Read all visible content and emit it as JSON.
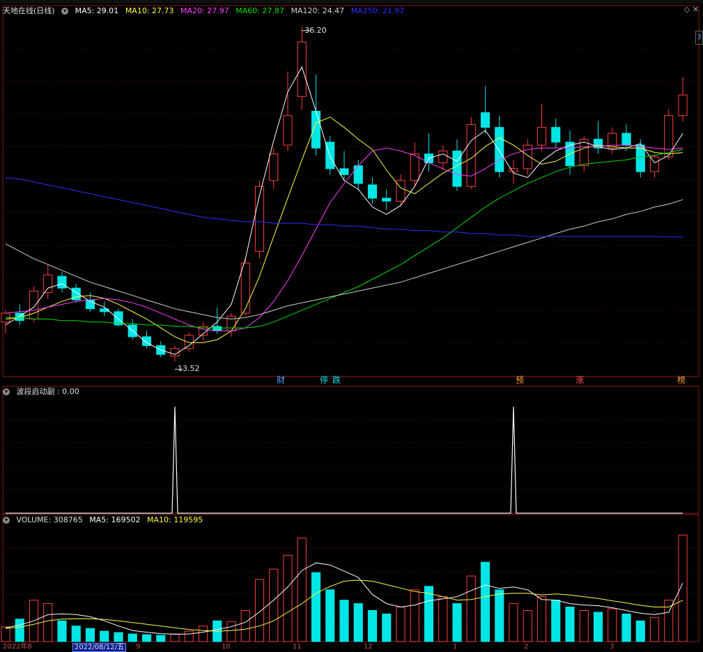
{
  "main_header": {
    "title": "天地在线(日线)",
    "ma5": "MA5: 29.01",
    "ma10": "MA10: 27.73",
    "ma20": "MA20: 27.97",
    "ma60": "MA60: 27.87",
    "ma120": "MA120: 24.47",
    "ma250": "MA250: 21.97"
  },
  "indicator_header": {
    "label": "波段启动副 : 0.00"
  },
  "volume_header": {
    "volume": "VOLUME: 308765",
    "ma5": "MA5: 169502",
    "ma10": "MA10: 119595"
  },
  "annotations": {
    "high": "36.20",
    "low": "13.52"
  },
  "event_markers": [
    {
      "label": "财",
      "color": "#4aa3ff"
    },
    {
      "label": "停",
      "color": "#00e5e5"
    },
    {
      "label": "跌",
      "color": "#00e5e5"
    },
    {
      "label": "预",
      "color": "#ff9933"
    },
    {
      "label": "涨",
      "color": "#ff5555"
    },
    {
      "label": "榜",
      "color": "#ff9933"
    }
  ],
  "x_axis": {
    "selected_date": "2022/08/12/五",
    "months": [
      "2022年8",
      "9",
      "10",
      "11",
      "12",
      "1",
      "2",
      "3"
    ]
  },
  "scale_button": "3",
  "colors": {
    "up": "#ff4040",
    "down": "#00e5e5",
    "ma5": "#ffffff",
    "ma10": "#ffff40",
    "ma20": "#ff40ff",
    "ma60": "#00e000",
    "ma120": "#d0d0d0",
    "ma250": "#3030ff"
  },
  "chart_data": [
    {
      "type": "candlestick",
      "title": "天地在线(日线)",
      "ylim": [
        12.5,
        37.0
      ],
      "grid": true,
      "series": [
        {
          "name": "MA5",
          "values": [
            16.0,
            16.6,
            17.2,
            18.5,
            18.8,
            18.2,
            17.6,
            17.2,
            16.4,
            15.6,
            14.8,
            14.3,
            14.0,
            14.6,
            15.4,
            16.2,
            17.4,
            20.5,
            24.8,
            28.5,
            31.8,
            33.5,
            30.5,
            27.4,
            25.8,
            25.2,
            24.0,
            23.5,
            24.1,
            25.4,
            27.3,
            27.6,
            27.1,
            28.5,
            29.2,
            27.8,
            26.3,
            26.0,
            27.1,
            27.8,
            28.2,
            28.4,
            28.1,
            27.9,
            28.0,
            28.3,
            27.0,
            27.5,
            29.0
          ]
        },
        {
          "name": "MA10",
          "values": [
            16.4,
            16.5,
            16.8,
            17.2,
            17.6,
            17.9,
            18.0,
            17.8,
            17.4,
            16.9,
            16.4,
            15.8,
            15.2,
            14.8,
            14.8,
            15.0,
            15.6,
            17.1,
            19.3,
            22.0,
            24.6,
            27.2,
            29.7,
            30.1,
            29.4,
            28.6,
            27.9,
            26.5,
            25.3,
            24.9,
            25.6,
            26.3,
            26.8,
            27.3,
            28.1,
            28.7,
            28.2,
            27.5,
            26.9,
            27.1,
            27.6,
            28.0,
            28.2,
            28.1,
            28.0,
            28.0,
            27.7,
            27.6,
            27.7
          ]
        },
        {
          "name": "MA20",
          "values": [
            16.8,
            16.9,
            17.0,
            17.2,
            17.4,
            17.6,
            17.7,
            17.8,
            17.7,
            17.5,
            17.2,
            16.8,
            16.4,
            16.0,
            15.7,
            15.6,
            15.6,
            15.8,
            16.5,
            17.6,
            19.0,
            20.7,
            22.5,
            24.3,
            25.6,
            26.8,
            27.8,
            28.0,
            27.8,
            27.5,
            27.0,
            26.6,
            26.2,
            26.1,
            26.6,
            27.2,
            27.6,
            27.9,
            28.0,
            28.0,
            28.0,
            28.1,
            28.1,
            28.2,
            28.2,
            28.1,
            28.0,
            27.9,
            28.0
          ]
        },
        {
          "name": "MA60",
          "values": [
            16.5,
            16.5,
            16.4,
            16.4,
            16.3,
            16.3,
            16.2,
            16.2,
            16.1,
            16.1,
            16.0,
            16.0,
            15.9,
            15.9,
            15.8,
            15.8,
            15.8,
            15.8,
            15.9,
            16.2,
            16.6,
            17.0,
            17.4,
            17.8,
            18.2,
            18.6,
            19.1,
            19.6,
            20.1,
            20.7,
            21.3,
            21.9,
            22.6,
            23.3,
            24.0,
            24.6,
            25.1,
            25.6,
            26.0,
            26.4,
            26.7,
            26.9,
            27.0,
            27.1,
            27.2,
            27.4,
            27.5,
            27.7,
            27.9
          ]
        },
        {
          "name": "MA120",
          "values": [
            21.5,
            21.0,
            20.5,
            20.1,
            19.7,
            19.3,
            18.9,
            18.6,
            18.3,
            18.0,
            17.7,
            17.4,
            17.1,
            16.9,
            16.7,
            16.5,
            16.4,
            16.5,
            16.7,
            17.0,
            17.3,
            17.5,
            17.7,
            17.9,
            18.1,
            18.3,
            18.5,
            18.7,
            18.9,
            19.2,
            19.5,
            19.8,
            20.1,
            20.4,
            20.7,
            21.0,
            21.3,
            21.6,
            21.9,
            22.2,
            22.5,
            22.7,
            23.0,
            23.2,
            23.5,
            23.7,
            24.0,
            24.2,
            24.5
          ]
        },
        {
          "name": "MA250",
          "values": [
            26.0,
            25.9,
            25.7,
            25.5,
            25.3,
            25.1,
            24.9,
            24.7,
            24.5,
            24.3,
            24.1,
            23.9,
            23.7,
            23.5,
            23.3,
            23.2,
            23.1,
            23.0,
            23.0,
            22.9,
            22.9,
            22.9,
            22.8,
            22.8,
            22.7,
            22.7,
            22.6,
            22.5,
            22.5,
            22.4,
            22.4,
            22.3,
            22.3,
            22.2,
            22.2,
            22.1,
            22.1,
            22.0,
            22.0,
            22.0,
            22.0,
            22.0,
            22.0,
            22.0,
            22.0,
            22.0,
            22.0,
            21.97,
            21.97
          ]
        }
      ],
      "candles": [
        {
          "o": 16.2,
          "h": 17.0,
          "l": 15.4,
          "c": 16.8
        },
        {
          "o": 16.8,
          "h": 17.4,
          "l": 16.0,
          "c": 16.3
        },
        {
          "o": 16.4,
          "h": 18.6,
          "l": 16.2,
          "c": 18.3
        },
        {
          "o": 18.2,
          "h": 20.1,
          "l": 17.8,
          "c": 19.4
        },
        {
          "o": 19.3,
          "h": 19.6,
          "l": 18.2,
          "c": 18.5
        },
        {
          "o": 18.5,
          "h": 18.8,
          "l": 17.5,
          "c": 17.7
        },
        {
          "o": 17.7,
          "h": 18.2,
          "l": 16.9,
          "c": 17.1
        },
        {
          "o": 17.1,
          "h": 17.6,
          "l": 16.6,
          "c": 16.9
        },
        {
          "o": 16.9,
          "h": 17.1,
          "l": 15.9,
          "c": 16.0
        },
        {
          "o": 16.0,
          "h": 16.4,
          "l": 15.0,
          "c": 15.2
        },
        {
          "o": 15.2,
          "h": 15.6,
          "l": 14.4,
          "c": 14.6
        },
        {
          "o": 14.6,
          "h": 14.9,
          "l": 13.8,
          "c": 14.0
        },
        {
          "o": 13.9,
          "h": 14.6,
          "l": 13.52,
          "c": 14.4
        },
        {
          "o": 14.4,
          "h": 15.5,
          "l": 14.2,
          "c": 15.3
        },
        {
          "o": 15.3,
          "h": 16.2,
          "l": 14.9,
          "c": 15.9
        },
        {
          "o": 15.9,
          "h": 17.2,
          "l": 15.4,
          "c": 15.6
        },
        {
          "o": 15.6,
          "h": 16.8,
          "l": 15.2,
          "c": 16.6
        },
        {
          "o": 16.8,
          "h": 20.6,
          "l": 16.6,
          "c": 20.2
        },
        {
          "o": 21.0,
          "h": 25.8,
          "l": 20.5,
          "c": 25.4
        },
        {
          "o": 25.8,
          "h": 28.0,
          "l": 25.2,
          "c": 27.6
        },
        {
          "o": 28.2,
          "h": 33.2,
          "l": 27.8,
          "c": 30.2
        },
        {
          "o": 31.5,
          "h": 36.2,
          "l": 30.6,
          "c": 35.2
        },
        {
          "o": 30.5,
          "h": 33.0,
          "l": 27.5,
          "c": 28.0
        },
        {
          "o": 28.4,
          "h": 28.8,
          "l": 26.2,
          "c": 26.6
        },
        {
          "o": 26.6,
          "h": 27.8,
          "l": 25.8,
          "c": 26.2
        },
        {
          "o": 26.8,
          "h": 27.2,
          "l": 25.2,
          "c": 25.6
        },
        {
          "o": 25.5,
          "h": 26.0,
          "l": 24.2,
          "c": 24.6
        },
        {
          "o": 24.6,
          "h": 25.2,
          "l": 23.8,
          "c": 24.4
        },
        {
          "o": 24.4,
          "h": 26.2,
          "l": 24.1,
          "c": 25.8
        },
        {
          "o": 25.8,
          "h": 28.4,
          "l": 25.4,
          "c": 27.6
        },
        {
          "o": 27.6,
          "h": 29.0,
          "l": 26.4,
          "c": 27.0
        },
        {
          "o": 27.0,
          "h": 28.2,
          "l": 26.5,
          "c": 27.8
        },
        {
          "o": 27.8,
          "h": 28.6,
          "l": 25.1,
          "c": 25.4
        },
        {
          "o": 25.4,
          "h": 30.1,
          "l": 25.2,
          "c": 29.6
        },
        {
          "o": 30.4,
          "h": 32.2,
          "l": 29.0,
          "c": 29.4
        },
        {
          "o": 29.4,
          "h": 30.2,
          "l": 26.0,
          "c": 26.4
        },
        {
          "o": 26.4,
          "h": 27.2,
          "l": 25.6,
          "c": 26.6
        },
        {
          "o": 26.6,
          "h": 28.6,
          "l": 26.2,
          "c": 28.2
        },
        {
          "o": 28.2,
          "h": 31.0,
          "l": 27.8,
          "c": 29.4
        },
        {
          "o": 29.4,
          "h": 30.0,
          "l": 28.0,
          "c": 28.4
        },
        {
          "o": 28.4,
          "h": 29.2,
          "l": 26.2,
          "c": 26.8
        },
        {
          "o": 26.8,
          "h": 28.8,
          "l": 26.4,
          "c": 28.6
        },
        {
          "o": 28.6,
          "h": 29.8,
          "l": 27.6,
          "c": 28.0
        },
        {
          "o": 28.0,
          "h": 29.4,
          "l": 27.6,
          "c": 29.0
        },
        {
          "o": 29.0,
          "h": 29.6,
          "l": 27.8,
          "c": 28.2
        },
        {
          "o": 28.2,
          "h": 28.6,
          "l": 26.0,
          "c": 26.4
        },
        {
          "o": 26.4,
          "h": 27.6,
          "l": 26.0,
          "c": 27.4
        },
        {
          "o": 27.4,
          "h": 30.6,
          "l": 27.2,
          "c": 30.2
        },
        {
          "o": 30.2,
          "h": 32.8,
          "l": 29.8,
          "c": 31.6
        }
      ]
    },
    {
      "type": "line",
      "title": "波段启动副",
      "values": [
        0,
        0,
        0,
        0,
        0,
        0,
        0,
        0,
        0,
        0,
        0,
        0,
        1,
        0,
        0,
        0,
        0,
        0,
        0,
        0,
        0,
        0,
        0,
        0,
        0,
        0,
        0,
        0,
        0,
        0,
        0,
        0,
        0,
        0,
        0,
        0,
        1,
        0,
        0,
        0,
        0,
        0,
        0,
        0,
        0,
        0,
        0,
        0,
        0
      ],
      "ylim": [
        0,
        1.1
      ]
    },
    {
      "type": "bar",
      "title": "VOLUME",
      "values": [
        42000,
        65000,
        120000,
        110000,
        60000,
        45000,
        38000,
        30000,
        26000,
        22000,
        20000,
        18000,
        22000,
        30000,
        45000,
        60000,
        58000,
        90000,
        180000,
        210000,
        250000,
        300000,
        200000,
        150000,
        120000,
        110000,
        90000,
        80000,
        100000,
        150000,
        160000,
        130000,
        110000,
        190000,
        230000,
        150000,
        110000,
        90000,
        130000,
        120000,
        100000,
        90000,
        85000,
        95000,
        80000,
        60000,
        70000,
        120000,
        308765
      ],
      "series": [
        {
          "name": "MA5",
          "values": [
            40000,
            48000,
            60000,
            78000,
            80000,
            78000,
            72000,
            60000,
            45000,
            32000,
            27000,
            23000,
            21000,
            22000,
            27000,
            35000,
            43000,
            56000,
            86000,
            120000,
            158000,
            206000,
            228000,
            222000,
            204000,
            186000,
            136000,
            110000,
            100000,
            106000,
            118000,
            124000,
            130000,
            148000,
            164000,
            154000,
            158000,
            150000,
            122000,
            120000,
            110000,
            106000,
            104000,
            98000,
            90000,
            82000,
            78000,
            85000,
            169502
          ]
        },
        {
          "name": "MA10",
          "values": [
            38000,
            42000,
            50000,
            60000,
            65000,
            66000,
            66000,
            64000,
            60000,
            55000,
            50000,
            45000,
            40000,
            35000,
            32000,
            30000,
            32000,
            36000,
            45000,
            60000,
            85000,
            110000,
            140000,
            160000,
            175000,
            178000,
            175000,
            165000,
            155000,
            145000,
            140000,
            130000,
            120000,
            122000,
            130000,
            138000,
            140000,
            140000,
            135000,
            138000,
            135000,
            130000,
            125000,
            118000,
            112000,
            105000,
            100000,
            100000,
            119595
          ]
        }
      ]
    }
  ]
}
